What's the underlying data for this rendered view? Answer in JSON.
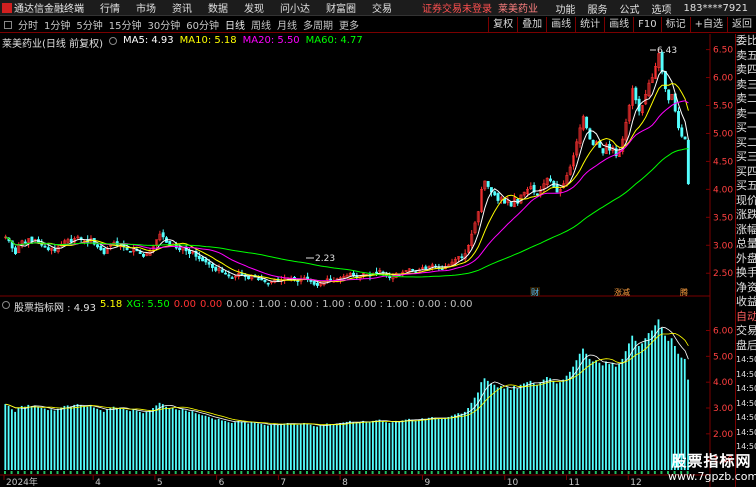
{
  "menubar": {
    "app_title": "通达信金融终端",
    "items": [
      "行情",
      "市场",
      "资讯",
      "数据",
      "发现",
      "问小达",
      "财富圈",
      "交易"
    ],
    "trade_warning": "证券交易未登录",
    "stock_name": "莱美药业",
    "right_items": [
      "功能",
      "服务",
      "公式",
      "选项"
    ],
    "user": "183****7921"
  },
  "toolbar": {
    "periods": [
      "分时",
      "1分钟",
      "5分钟",
      "15分钟",
      "30分钟",
      "60分钟",
      "日线",
      "周线",
      "月线",
      "多周期",
      "更多"
    ],
    "active_period": "日线",
    "right_buttons": [
      "复权",
      "叠加",
      "画线",
      "统计",
      "画线",
      "F10",
      "标记",
      "+自选",
      "返回"
    ]
  },
  "main_legend": {
    "title": "莱美药业(日线 前复权)",
    "ma5": "MA5: 4.93",
    "ma10": "MA10: 5.18",
    "ma20": "MA20: 5.50",
    "ma60": "MA60: 4.77"
  },
  "indicator_legend": {
    "name": "股票指标网 : 4.93",
    "v1": "5.18",
    "xg": "XG: 5.50",
    "v2": "0.00",
    "v3": "0.00",
    "v4": "0.00 : 1.00 : 0.00 : 1.00 : 0.00 : 1.00 : 0.00 : 0.00"
  },
  "price_axis_labels": [
    "6.50",
    "6.00",
    "5.50",
    "5.00",
    "4.50",
    "4.00",
    "3.50",
    "3.00",
    "2.50"
  ],
  "indicator_axis_labels": [
    "6.00",
    "5.00",
    "4.00",
    "3.00",
    "2.00",
    "1.00"
  ],
  "time_axis_labels": [
    "2024年",
    "4",
    "5",
    "6",
    "7",
    "8",
    "9",
    "10",
    "11",
    "12"
  ],
  "annotations": {
    "high": "6.43",
    "low": "2.23",
    "event_cai": "财",
    "event_zhangjian": "涨减",
    "event_teng": "腾"
  },
  "right_panel": [
    "委比",
    "卖五",
    "卖四",
    "卖三",
    "卖二",
    "卖一",
    "买一",
    "买二",
    "买三",
    "买四",
    "买五",
    "现价",
    "涨跌",
    "涨幅",
    "总量",
    "外盘",
    "换手",
    "净资",
    "收益",
    "自动",
    "交易",
    "盘后",
    "14:50",
    "14:50",
    "14:50",
    "14:50",
    "14:50",
    "14:50",
    "14:50"
  ],
  "watermark": {
    "line1": "股票指标网",
    "line2": "www.7gpzb.com"
  },
  "colors": {
    "up": "#ff3232",
    "down": "#54ffff",
    "ma5": "#ffffff",
    "ma10": "#ffff00",
    "ma20": "#ff00ff",
    "ma60": "#00ff00",
    "axis_border": "#7a0000"
  },
  "chart_data": {
    "type": "candlestick",
    "ylim": [
      2.2,
      6.6
    ],
    "closes": [
      3.15,
      3.08,
      2.95,
      2.85,
      3.0,
      3.08,
      3.05,
      3.12,
      3.06,
      3.1,
      3.05,
      3.0,
      2.98,
      2.92,
      2.95,
      2.9,
      2.97,
      3.02,
      3.08,
      3.1,
      3.06,
      3.12,
      3.15,
      3.1,
      3.08,
      3.05,
      3.12,
      3.02,
      2.97,
      2.92,
      2.85,
      2.95,
      3.0,
      3.05,
      3.0,
      3.02,
      2.97,
      2.92,
      2.88,
      2.95,
      2.9,
      2.85,
      2.8,
      2.85,
      2.9,
      3.0,
      3.1,
      3.2,
      3.15,
      3.05,
      3.0,
      3.02,
      2.95,
      2.92,
      2.96,
      2.9,
      2.85,
      2.88,
      2.8,
      2.76,
      2.72,
      2.7,
      2.66,
      2.6,
      2.55,
      2.58,
      2.52,
      2.5,
      2.45,
      2.42,
      2.45,
      2.5,
      2.48,
      2.44,
      2.4,
      2.46,
      2.43,
      2.4,
      2.38,
      2.35,
      2.32,
      2.35,
      2.38,
      2.36,
      2.38,
      2.4,
      2.42,
      2.4,
      2.38,
      2.35,
      2.4,
      2.42,
      2.39,
      2.35,
      2.3,
      2.28,
      2.32,
      2.36,
      2.4,
      2.38,
      2.36,
      2.4,
      2.42,
      2.44,
      2.46,
      2.5,
      2.45,
      2.42,
      2.46,
      2.5,
      2.48,
      2.45,
      2.5,
      2.52,
      2.55,
      2.5,
      2.45,
      2.42,
      2.45,
      2.5,
      2.48,
      2.52,
      2.55,
      2.58,
      2.55,
      2.52,
      2.56,
      2.6,
      2.58,
      2.62,
      2.65,
      2.62,
      2.6,
      2.58,
      2.62,
      2.65,
      2.7,
      2.75,
      2.8,
      2.78,
      2.85,
      3.0,
      3.2,
      3.4,
      3.6,
      4.0,
      4.15,
      4.05,
      3.95,
      3.9,
      3.8,
      3.85,
      3.75,
      3.8,
      3.7,
      3.85,
      3.75,
      3.9,
      3.95,
      4.0,
      4.05,
      3.95,
      3.9,
      4.0,
      4.1,
      4.2,
      4.15,
      4.05,
      3.95,
      4.0,
      4.1,
      4.25,
      4.4,
      4.6,
      4.85,
      5.1,
      5.3,
      5.1,
      4.9,
      4.8,
      4.85,
      4.75,
      4.65,
      4.8,
      4.7,
      4.75,
      4.6,
      4.7,
      4.9,
      5.2,
      5.5,
      5.8,
      5.6,
      5.4,
      5.5,
      5.7,
      5.9,
      6.0,
      6.2,
      6.43,
      6.1,
      5.8,
      5.6,
      5.7,
      5.4,
      5.1,
      4.95,
      4.9,
      4.1
    ],
    "ma60_curve_note": ""
  }
}
